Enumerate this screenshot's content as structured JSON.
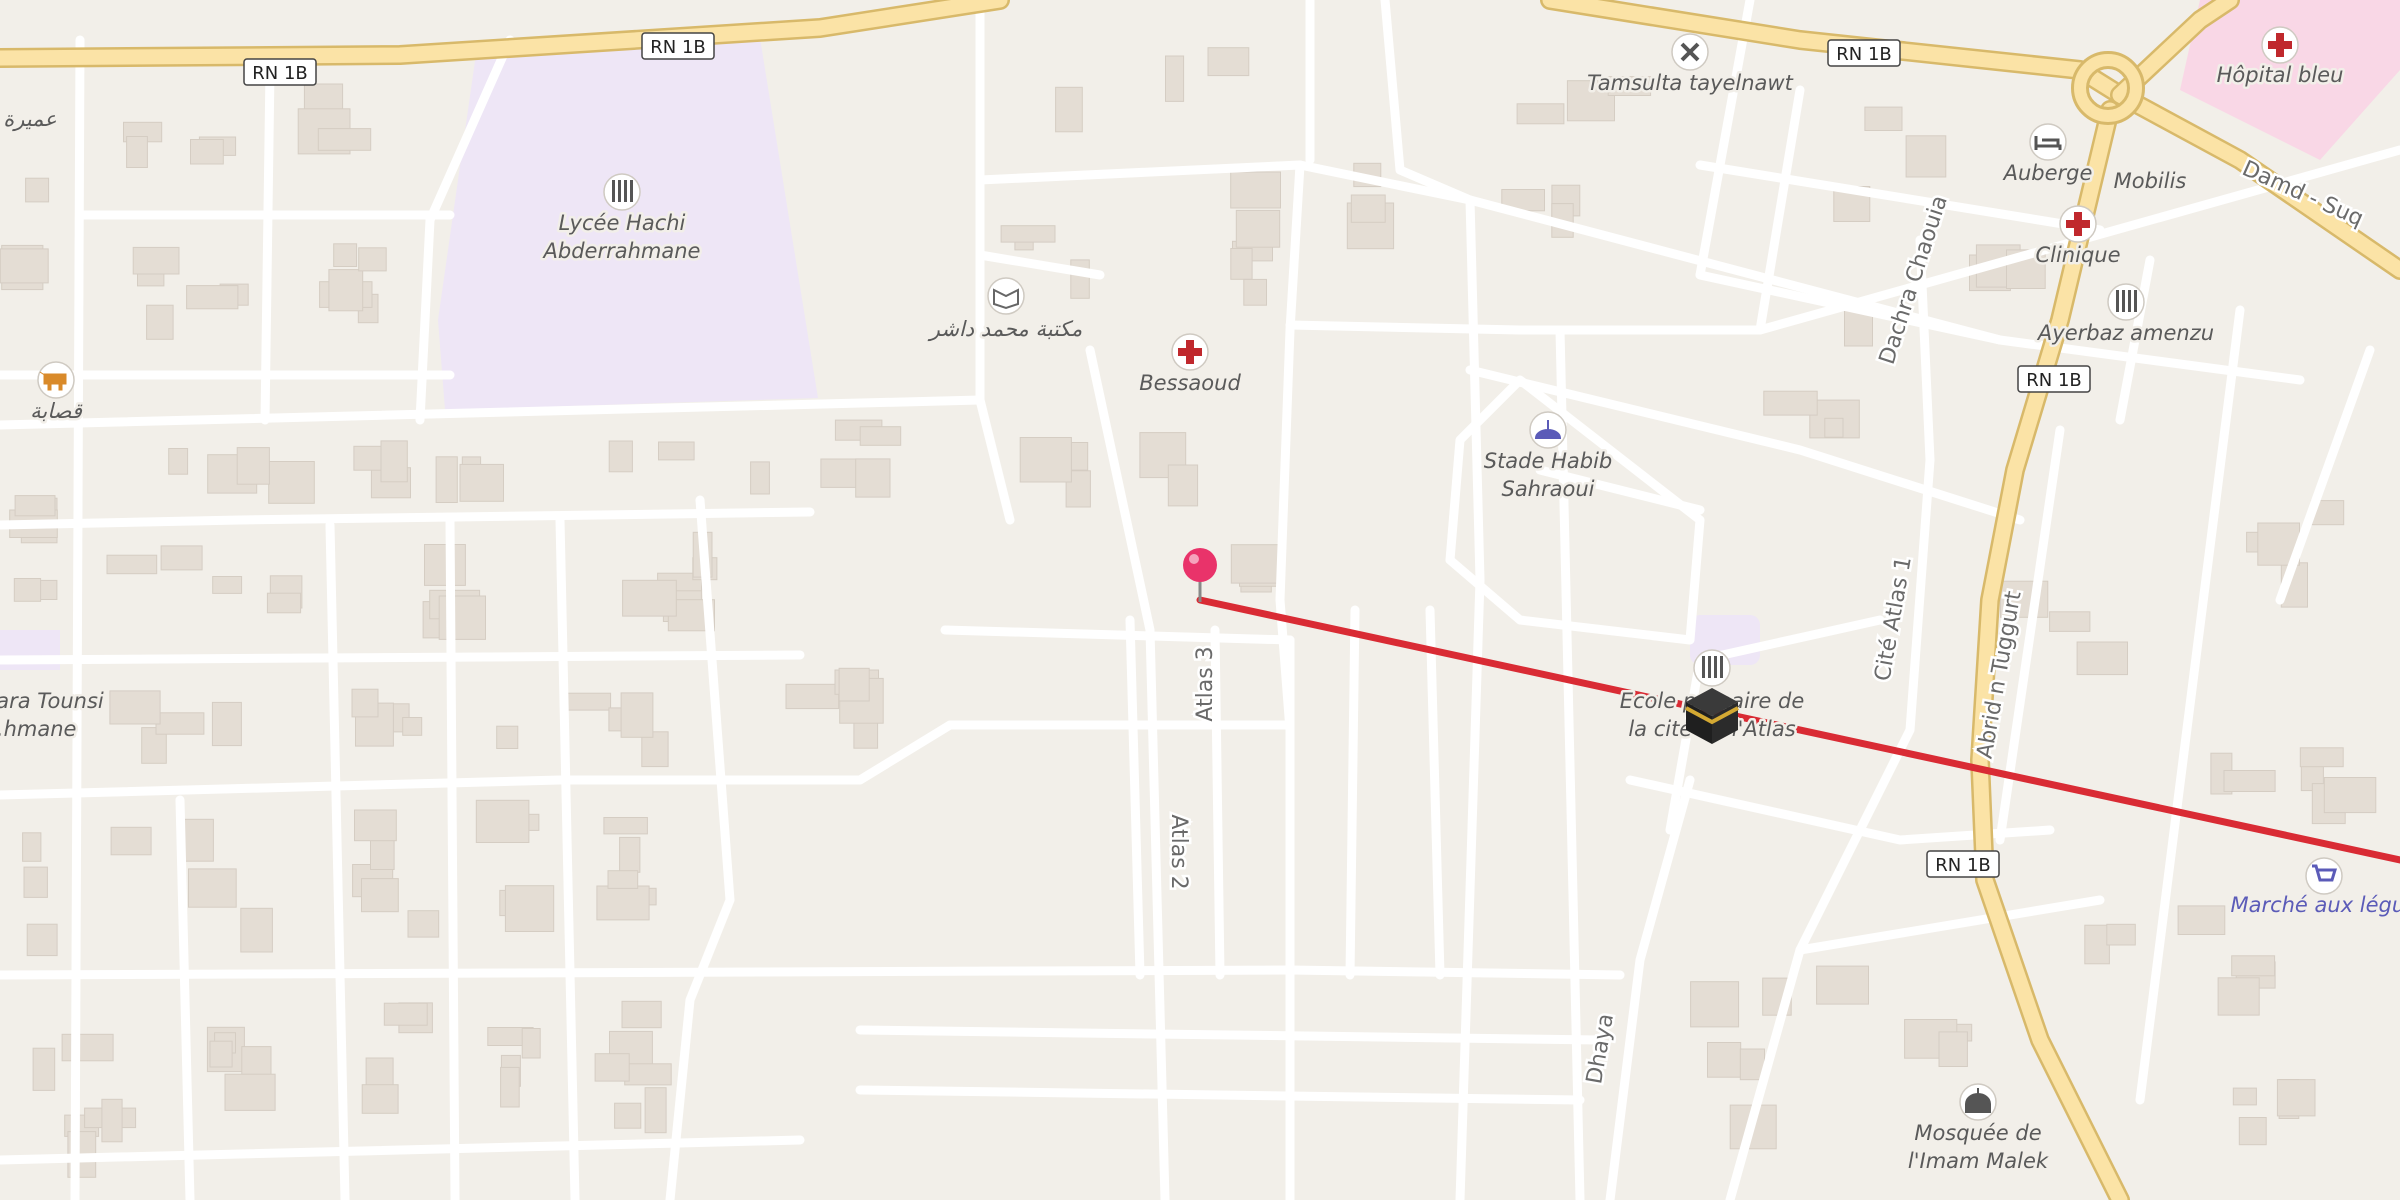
{
  "map": {
    "route_color": "#d92b34",
    "pin_color": "#e9336a",
    "landmark_icon": "kaaba-icon",
    "route_badges": [
      {
        "id": "rn1b-1",
        "text": "RN 1B"
      },
      {
        "id": "rn1b-2",
        "text": "RN 1B"
      },
      {
        "id": "rn1b-3",
        "text": "RN 1B"
      },
      {
        "id": "rn1b-4",
        "text": "RN 1B"
      },
      {
        "id": "rn1b-5",
        "text": "RN 1B"
      }
    ],
    "street_labels": [
      {
        "id": "atlas3",
        "text": "Atlas 3"
      },
      {
        "id": "atlas2",
        "text": "Atlas 2"
      },
      {
        "id": "dhaya",
        "text": "Dhaya"
      },
      {
        "id": "cite-atlas1",
        "text": "Cité Atlas 1"
      },
      {
        "id": "dachra",
        "text": "Dachra Chaouia"
      },
      {
        "id": "abrid",
        "text": "Abrid n Tuggurt"
      },
      {
        "id": "damd",
        "text": "Damd - Suq"
      }
    ],
    "pois": [
      {
        "id": "lycee",
        "icon": "school-icon",
        "lines": [
          "Lycée Hachi",
          "Abderrahmane"
        ]
      },
      {
        "id": "bibliotheque",
        "icon": "library-icon",
        "lines": [
          "مكتبة محمد داشر"
        ]
      },
      {
        "id": "bessaoud",
        "icon": "medical-cross-icon",
        "lines": [
          "Bessaoud"
        ]
      },
      {
        "id": "tamsulta",
        "icon": "tools-icon",
        "lines": [
          "Tamsulta tayelnawt"
        ]
      },
      {
        "id": "hopital",
        "icon": "medical-cross-icon",
        "lines": [
          "Hôpital bleu"
        ]
      },
      {
        "id": "auberge",
        "icon": "bed-icon",
        "lines": [
          "Auberge"
        ]
      },
      {
        "id": "mobilis",
        "icon": "",
        "lines": [
          "Mobilis"
        ]
      },
      {
        "id": "clinique",
        "icon": "medical-cross-icon",
        "lines": [
          "Clinique"
        ]
      },
      {
        "id": "ayerbaz",
        "icon": "school-icon",
        "lines": [
          "Ayerbaz amenzu"
        ]
      },
      {
        "id": "stade",
        "icon": "stadium-icon",
        "lines": [
          "Stade Habib",
          "Sahraoui"
        ]
      },
      {
        "id": "ecole",
        "icon": "school-icon",
        "lines": [
          "Ecole primaire de",
          "la cité de l'Atlas"
        ]
      },
      {
        "id": "marche",
        "icon": "shopping-cart-icon",
        "lines": [
          "Marché aux légumes"
        ]
      },
      {
        "id": "mosquee",
        "icon": "mosque-icon",
        "lines": [
          "Mosquée de",
          "l'Imam Malek"
        ]
      },
      {
        "id": "boucherie",
        "icon": "cow-icon",
        "lines": [
          "قصابة"
        ]
      },
      {
        "id": "amira",
        "icon": "",
        "lines": [
          "عميرة"
        ]
      },
      {
        "id": "tounsi",
        "icon": "",
        "lines": [
          "...ara Tounsi",
          "...hmane"
        ]
      }
    ]
  }
}
